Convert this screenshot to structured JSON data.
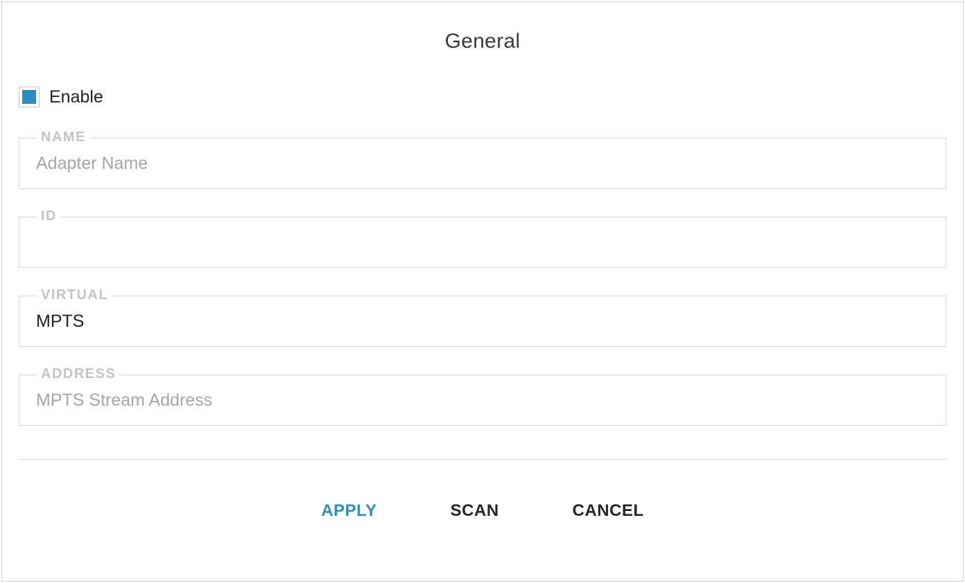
{
  "panel": {
    "title": "General"
  },
  "enable": {
    "label": "Enable",
    "checked": true
  },
  "fields": {
    "name": {
      "label": "NAME",
      "placeholder": "Adapter Name",
      "value": ""
    },
    "id": {
      "label": "ID",
      "placeholder": "",
      "value": ""
    },
    "virtual": {
      "label": "VIRTUAL",
      "value": "MPTS"
    },
    "address": {
      "label": "ADDRESS",
      "placeholder": "MPTS Stream Address",
      "value": ""
    }
  },
  "buttons": {
    "apply": "APPLY",
    "scan": "SCAN",
    "cancel": "CANCEL"
  }
}
